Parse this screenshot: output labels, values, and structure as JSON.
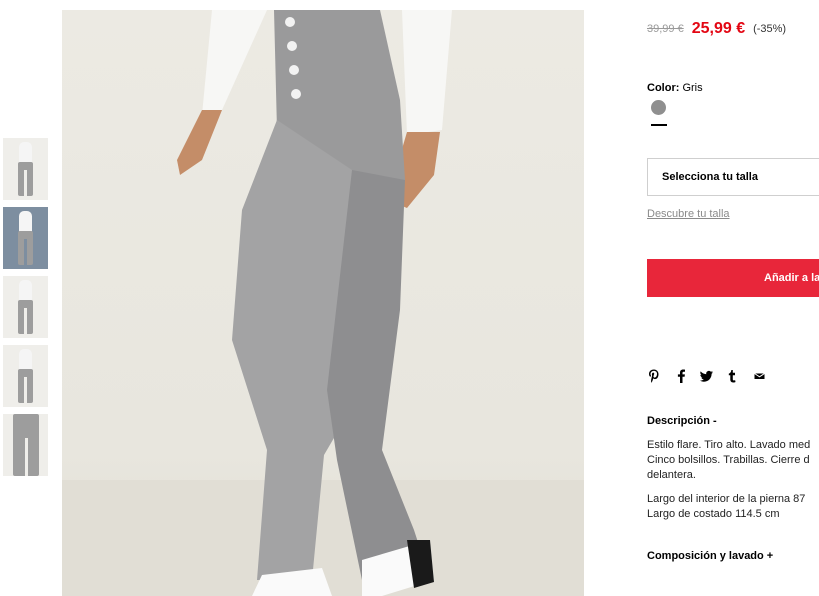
{
  "product": {
    "old_price": "39,99 €",
    "new_price": "25,99 €",
    "discount": "(-35%)",
    "color_label": "Color:",
    "color_value": "Gris",
    "swatch_color": "#8f8f8f",
    "size_select": "Selecciona tu talla",
    "size_guide": "Descubre tu talla",
    "add_to_bag": "Añadir a la",
    "accent_color": "#e8263a",
    "price_color": "#e30613"
  },
  "share_icons": [
    "pinterest-icon",
    "facebook-icon",
    "twitter-icon",
    "tumblr-icon",
    "mail-icon"
  ],
  "description": {
    "title": "Descripción -",
    "line1": "Estilo flare. Tiro alto. Lavado med",
    "line2": "Cinco bolsillos. Trabillas. Cierre d",
    "line3": "delantera.",
    "line4": "Largo del interior de la pierna 87",
    "line5": "Largo de costado 114.5 cm"
  },
  "composition": {
    "title": "Composición y lavado +"
  },
  "thumbnails": [
    {
      "label": "thumbnail-1"
    },
    {
      "label": "thumbnail-2"
    },
    {
      "label": "thumbnail-3"
    },
    {
      "label": "thumbnail-4"
    },
    {
      "label": "thumbnail-5"
    }
  ]
}
